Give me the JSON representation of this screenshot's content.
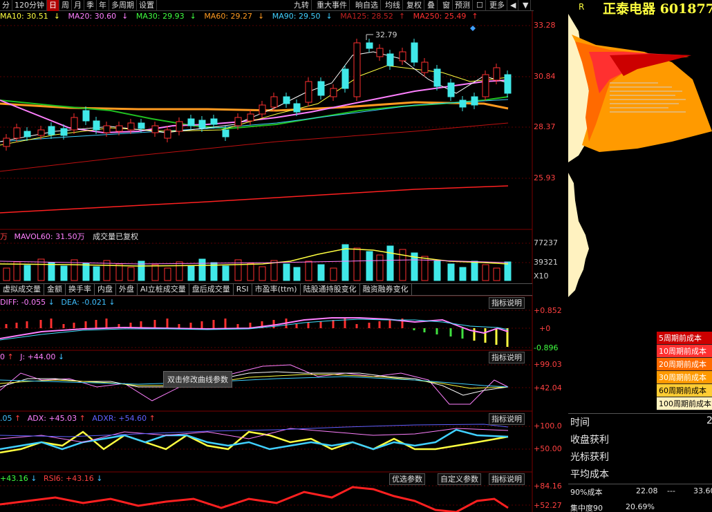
{
  "toolbar": {
    "left": [
      {
        "label": "分",
        "active": false
      },
      {
        "label": "120分钟",
        "active": false
      },
      {
        "label": "日",
        "active": true
      },
      {
        "label": "周",
        "active": false
      },
      {
        "label": "月",
        "active": false
      },
      {
        "label": "季",
        "active": false
      },
      {
        "label": "年",
        "active": false
      },
      {
        "label": "多周期",
        "active": false
      },
      {
        "label": "设置",
        "active": false
      }
    ],
    "right": [
      "九转",
      "重大事件",
      "晌自选",
      "均线",
      "复权",
      "叠",
      "窗",
      "预测",
      "☐",
      "更多",
      "◀",
      "▼"
    ]
  },
  "ma": {
    "ma10": "MA10: 30.51",
    "ma20": "MA20: 30.60",
    "ma30": "MA30: 29.93",
    "ma60": "MA60: 29.27",
    "ma90": "MA90: 29.50",
    "ma125": "MA125: 28.52",
    "ma250": "MA250: 25.49"
  },
  "price_axis": [
    "33.28",
    "30.84",
    "28.37",
    "25.93"
  ],
  "peak_label": "32.79",
  "volume": {
    "left_tag": "万",
    "mavol60": "MAVOL60: 31.50万",
    "label": "成交量已复权",
    "axis": [
      "77237",
      "39321",
      "X10"
    ]
  },
  "tabs": [
    "虚拟成交量",
    "金额",
    "换手率",
    "内盘",
    "外盘",
    "AI立桩成交量",
    "盘后成交量",
    "RSI",
    "市盈率(ttm)",
    "陆股通持股变化",
    "融资融券变化"
  ],
  "macd": {
    "diff": "DIFF: -0.055",
    "dea": "DEA: -0.021",
    "button": "指标说明",
    "axis": [
      "+0.852",
      "+0",
      "-0.896"
    ]
  },
  "kdj": {
    "left": "0",
    "j": "J: +44.00",
    "button": "指标说明",
    "axis": [
      "+99.03",
      "+42.04"
    ],
    "tooltip": "双击修改曲线参数"
  },
  "dmi": {
    "left": ".05",
    "adx": "ADX: +45.03",
    "adxr": "ADXR: +54.60",
    "button": "指标说明",
    "axis": [
      "+100.0",
      "+50.00"
    ]
  },
  "rsi": {
    "left": "+43.16",
    "rsi6": "RSI6: +43.16",
    "btn1": "优选参数",
    "btn2": "自定义参数",
    "button": "指标说明",
    "axis": [
      "+84.16",
      "+52.27"
    ]
  },
  "right_panel": {
    "r_tag": "R",
    "title": "正泰电器 601877",
    "legend": [
      "5周期前成本",
      "10周期前成本",
      "20周期前成本",
      "30周期前成本",
      "60周期前成本",
      "100周期前成本"
    ],
    "legend_colors": [
      "#cc0000",
      "#ff3030",
      "#ff6a00",
      "#ff9a00",
      "#ffcc33",
      "#fff2c0"
    ],
    "info": [
      "时间",
      "收盘获利",
      "光标获利",
      "平均成本"
    ],
    "time_val": "2",
    "cost90_label": "90%成本",
    "cost90_low": "22.08",
    "cost90_sep": "---",
    "cost90_high": "33.60",
    "conc90_label": "集中度90",
    "conc90_val": "20.69%"
  }
}
